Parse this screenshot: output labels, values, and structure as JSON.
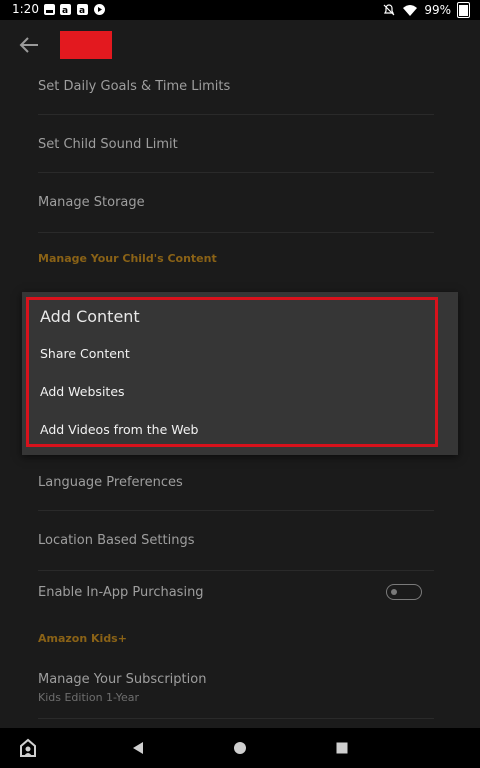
{
  "status_bar": {
    "time": "1:20",
    "battery": "99%"
  },
  "settings": {
    "set_daily_goals": "Set Daily Goals & Time Limits",
    "set_child_sound": "Set Child Sound Limit",
    "manage_storage": "Manage Storage",
    "section_content": "Manage Your Child's Content",
    "language_prefs": "Language Preferences",
    "location_settings": "Location Based Settings",
    "in_app_purchasing": "Enable In-App Purchasing",
    "in_app_purchasing_enabled": false,
    "section_kids": "Amazon Kids+",
    "manage_subscription": "Manage Your Subscription",
    "subscription_detail": "Kids Edition 1-Year"
  },
  "popup": {
    "title": "Add Content",
    "items": [
      "Share Content",
      "Add Websites",
      "Add Videos from the Web"
    ]
  },
  "colors": {
    "accent_section": "#8a6216",
    "highlight_outline": "#d8121c",
    "redacted": "#e3191f"
  }
}
